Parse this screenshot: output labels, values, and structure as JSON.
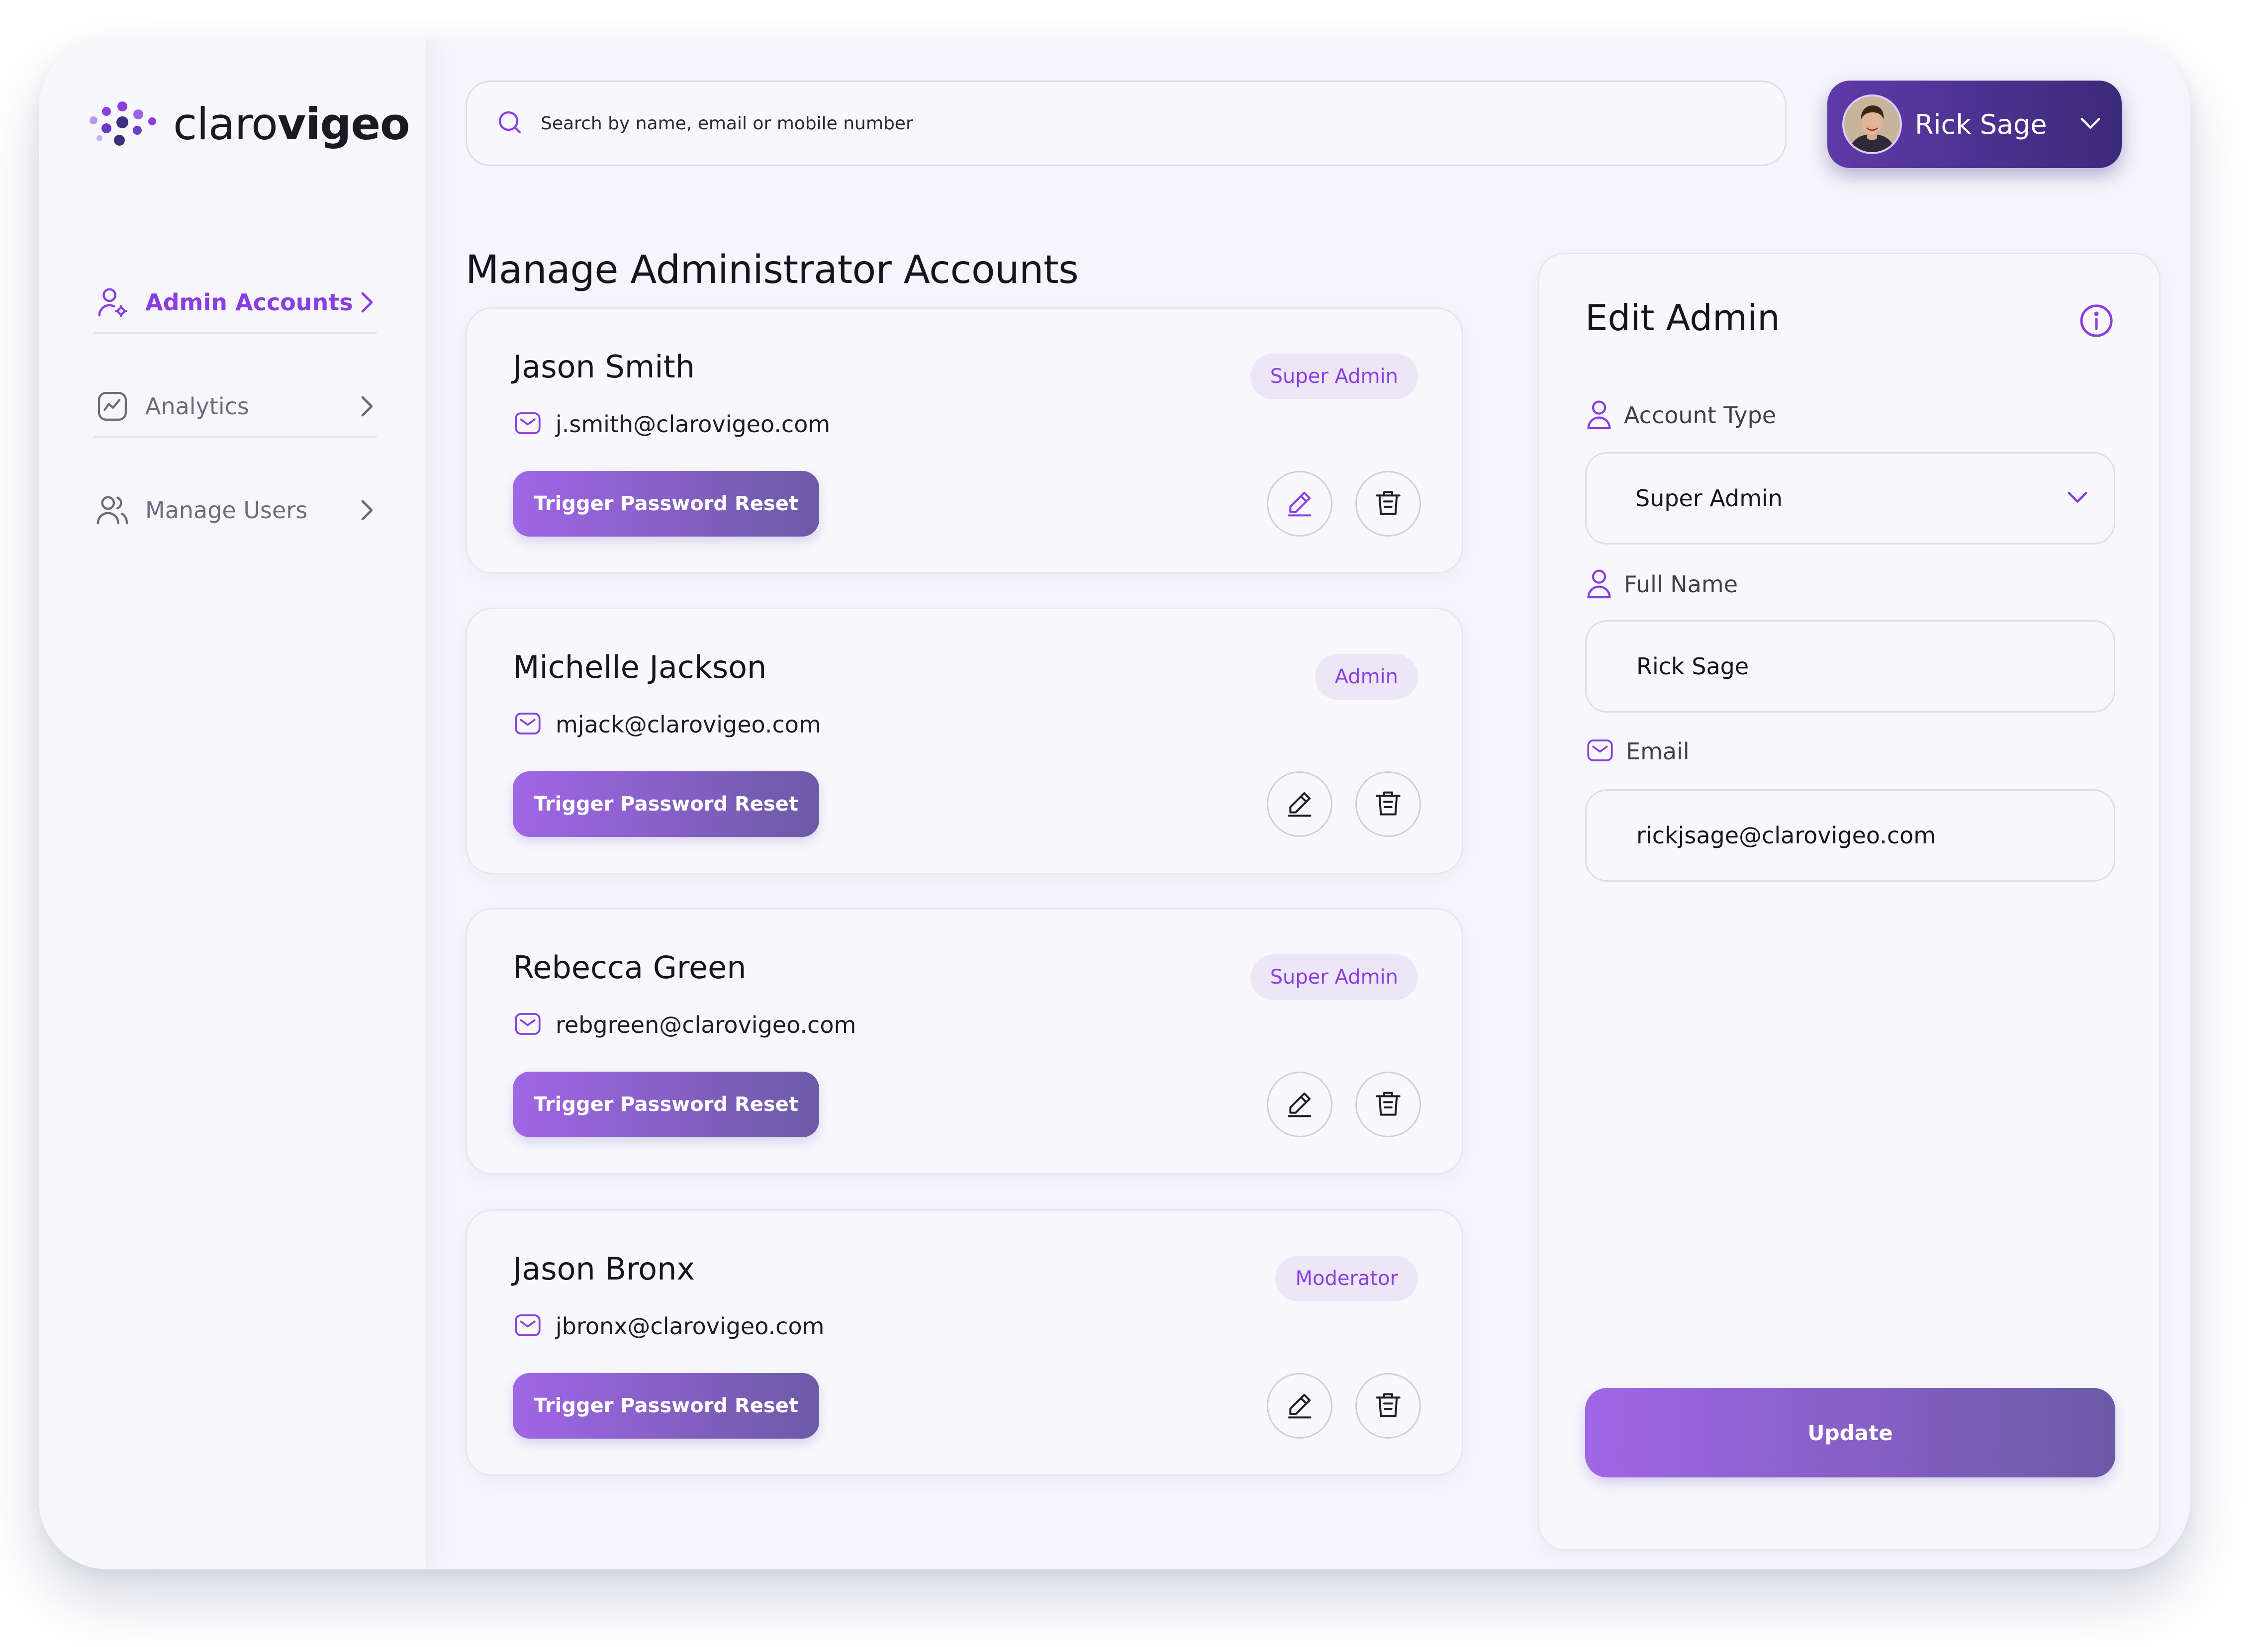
{
  "brand": {
    "name_light": "claro",
    "name_bold": "vigeo"
  },
  "sidebar": {
    "items": [
      {
        "label": "Admin Accounts",
        "icon": "user-settings-icon",
        "active": true
      },
      {
        "label": "Analytics",
        "icon": "analytics-icon",
        "active": false
      },
      {
        "label": "Manage Users",
        "icon": "users-icon",
        "active": false
      }
    ]
  },
  "search": {
    "placeholder": "Search by name, email or mobile number",
    "value": ""
  },
  "profile": {
    "name": "Rick Sage"
  },
  "main": {
    "title": "Manage Administrator Accounts",
    "reset_label": "Trigger Password Reset",
    "admins": [
      {
        "name": "Jason Smith",
        "email": "j.smith@clarovigeo.com",
        "role": "Super Admin"
      },
      {
        "name": "Michelle Jackson",
        "email": "mjack@clarovigeo.com",
        "role": "Admin"
      },
      {
        "name": "Rebecca Green",
        "email": "rebgreen@clarovigeo.com",
        "role": "Super Admin"
      },
      {
        "name": "Jason Bronx",
        "email": "jbronx@clarovigeo.com",
        "role": "Moderator"
      }
    ]
  },
  "edit_panel": {
    "title": "Edit Admin",
    "account_type_label": "Account Type",
    "account_type_value": "Super Admin",
    "full_name_label": "Full Name",
    "full_name_value": "Rick Sage",
    "email_label": "Email",
    "email_value": "rickjsage@clarovigeo.com",
    "update_label": "Update"
  },
  "colors": {
    "accent": "#8a3ee0",
    "profile_bg": "#4a3290",
    "badge_bg": "#ece6f7",
    "button_gradient_start": "#a066e6",
    "button_gradient_end": "#6c5aa6"
  }
}
